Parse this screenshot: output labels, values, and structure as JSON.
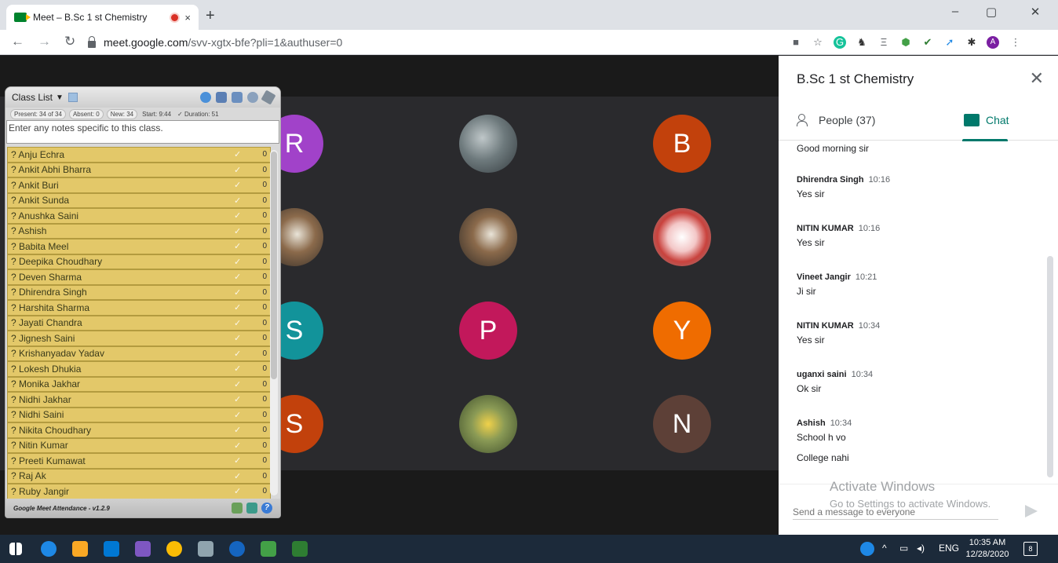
{
  "browser": {
    "tab_title": "Meet – B.Sc 1 st Chemistry",
    "tab_close": "×",
    "new_tab": "+",
    "url_host": "meet.google.com",
    "url_path": "/svv-xgtx-bfe?pli=1&authuser=0",
    "profile_initial": "A",
    "win_min": "–",
    "win_max": "▢",
    "win_close": "✕"
  },
  "class_list": {
    "title": "Class List",
    "present": "Present: 34 of 34",
    "absent": "Absent: 0",
    "new": "New: 34",
    "start": "Start: 9:44",
    "duration": "✓ Duration: 51",
    "notes_placeholder": "Enter any notes specific to this class.",
    "students": [
      "? Anju Echra",
      "? Ankit Abhi Bharra",
      "? Ankit Buri",
      "? Ankit Sunda",
      "? Anushka Saini",
      "? Ashish",
      "? Babita Meel",
      "? Deepika Choudhary",
      "? Deven Sharma",
      "? Dhirendra Singh",
      "? Harshita Sharma",
      "? Jayati Chandra",
      "? Jignesh Saini",
      "? Krishanyadav Yadav",
      "? Lokesh Dhukia",
      "? Monika Jakhar",
      "? Nidhi Jakhar",
      "? Nidhi Saini",
      "? Nikita Choudhary",
      "? Nitin Kumar",
      "? Preeti Kumawat",
      "? Raj Ak",
      "? Ruby Jangir"
    ],
    "row_count": "0",
    "footer": "Google Meet Attendance - v1.2.9"
  },
  "tiles": [
    {
      "letter": "R",
      "color": "#a142c9"
    },
    {
      "letter": "",
      "color": "photo"
    },
    {
      "letter": "B",
      "color": "#c2410c"
    },
    {
      "letter": "",
      "color": "photo2"
    },
    {
      "letter": "",
      "color": "photo2"
    },
    {
      "letter": "",
      "color": "photo3"
    },
    {
      "letter": "S",
      "color": "#12939a"
    },
    {
      "letter": "P",
      "color": "#c2185b"
    },
    {
      "letter": "Y",
      "color": "#ef6c00"
    },
    {
      "letter": "S",
      "color": "#c2410c"
    },
    {
      "letter": "",
      "color": "photo4"
    },
    {
      "letter": "N",
      "color": "#5d4037"
    }
  ],
  "side": {
    "title": "B.Sc 1 st Chemistry",
    "close": "✕",
    "people_tab": "People (37)",
    "chat_tab": "Chat",
    "composer_placeholder": "Send a message to everyone"
  },
  "messages": {
    "m0": {
      "txt": "Good morning sir"
    },
    "m1": {
      "who": "Dhirendra Singh",
      "time": "10:16",
      "txt": "Yes sir"
    },
    "m2": {
      "who": "NITIN KUMAR",
      "time": "10:16",
      "txt": "Yes sir"
    },
    "m3": {
      "who": "Vineet Jangir",
      "time": "10:21",
      "txt": "Ji sir"
    },
    "m4": {
      "who": "NITIN KUMAR",
      "time": "10:34",
      "txt": "Yes sir"
    },
    "m5": {
      "who": "uganxi saini",
      "time": "10:34",
      "txt": "Ok sir"
    },
    "m6": {
      "who": "Ashish",
      "time": "10:34",
      "txt": "School h vo"
    },
    "m7": {
      "txt": "College nahi"
    }
  },
  "watermark": {
    "line1": "Activate Windows",
    "line2": "Go to Settings to activate Windows."
  },
  "taskbar": {
    "lang": "ENG",
    "time": "10:35 AM",
    "date": "12/28/2020",
    "notif_count": "8"
  }
}
